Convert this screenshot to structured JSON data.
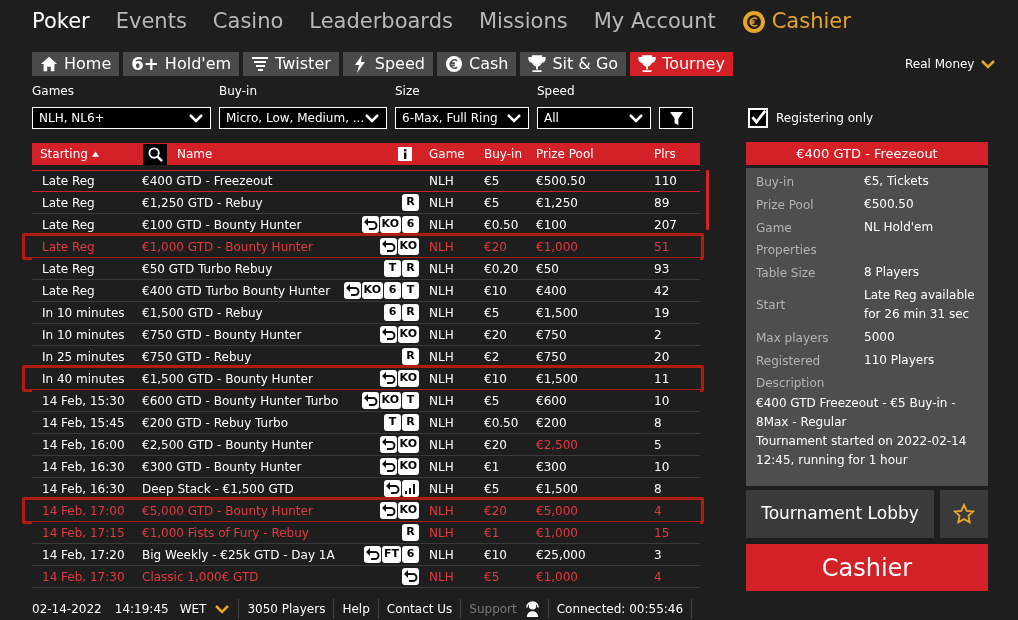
{
  "nav": [
    {
      "label": "Poker",
      "kind": "plain",
      "selected": true
    },
    {
      "label": "Events",
      "kind": "plain",
      "selected": false
    },
    {
      "label": "Casino",
      "kind": "plain",
      "selected": false
    },
    {
      "label": "Leaderboards",
      "kind": "plain",
      "selected": false
    },
    {
      "label": "Missions",
      "kind": "plain",
      "selected": false
    },
    {
      "label": "My Account",
      "kind": "plain",
      "selected": false
    },
    {
      "label": "Cashier",
      "kind": "cashier",
      "selected": false
    }
  ],
  "tabs": [
    {
      "label": "Home",
      "selected": false
    },
    {
      "label": "Hold'em",
      "icon_text": "6+",
      "selected": false
    },
    {
      "label": "Twister",
      "selected": false
    },
    {
      "label": "Speed",
      "selected": false
    },
    {
      "label": "Cash",
      "selected": false
    },
    {
      "label": "Sit & Go",
      "selected": false
    },
    {
      "label": "Tourney",
      "selected": true
    }
  ],
  "money_mode": "Real Money",
  "filters": [
    {
      "label": "Games",
      "value": "NLH, NL6+"
    },
    {
      "label": "Buy-in",
      "value": "Micro, Low, Medium, ..."
    },
    {
      "label": "Size",
      "value": "6-Max, Full Ring"
    },
    {
      "label": "Speed",
      "value": "All"
    }
  ],
  "registering_only": {
    "label": "Registering only",
    "checked": true
  },
  "table": {
    "columns": [
      "Starting",
      "Name",
      "Game",
      "Buy-in",
      "Prize Pool",
      "Plrs"
    ],
    "rows": [
      {
        "starting": "Late Reg",
        "name": "€400 GTD - Freezeout",
        "tags": [],
        "game": "NLH",
        "buy_in": "€5",
        "prize_pool": "€500.50",
        "players": "110",
        "selected": true,
        "alert": false,
        "outlined": false,
        "prize_alert": false
      },
      {
        "starting": "Late Reg",
        "name": "€1,250 GTD - Rebuy",
        "tags": [
          {
            "kind": "text",
            "label": "R"
          }
        ],
        "game": "NLH",
        "buy_in": "€5",
        "prize_pool": "€1,250",
        "players": "89",
        "selected": false,
        "alert": false,
        "outlined": false,
        "prize_alert": false
      },
      {
        "starting": "Late Reg",
        "name": "€100 GTD - Bounty Hunter",
        "tags": [
          {
            "kind": "arrow"
          },
          {
            "kind": "text",
            "label": "KO"
          },
          {
            "kind": "text",
            "label": "6"
          }
        ],
        "game": "NLH",
        "buy_in": "€0.50",
        "prize_pool": "€100",
        "players": "207",
        "selected": false,
        "alert": false,
        "outlined": false,
        "prize_alert": false
      },
      {
        "starting": "Late Reg",
        "name": "€1,000 GTD - Bounty Hunter",
        "tags": [
          {
            "kind": "arrow"
          },
          {
            "kind": "text",
            "label": "KO"
          }
        ],
        "game": "NLH",
        "buy_in": "€20",
        "prize_pool": "€1,000",
        "players": "51",
        "selected": false,
        "alert": true,
        "outlined": true,
        "prize_alert": false
      },
      {
        "starting": "Late Reg",
        "name": "€50 GTD Turbo Rebuy",
        "tags": [
          {
            "kind": "text",
            "label": "T"
          },
          {
            "kind": "text",
            "label": "R"
          }
        ],
        "game": "NLH",
        "buy_in": "€0.20",
        "prize_pool": "€50",
        "players": "93",
        "selected": false,
        "alert": false,
        "outlined": false,
        "prize_alert": false
      },
      {
        "starting": "Late Reg",
        "name": "€400 GTD Turbo Bounty Hunter",
        "tags": [
          {
            "kind": "arrow"
          },
          {
            "kind": "text",
            "label": "KO"
          },
          {
            "kind": "text",
            "label": "6"
          },
          {
            "kind": "text",
            "label": "T"
          }
        ],
        "game": "NLH",
        "buy_in": "€10",
        "prize_pool": "€400",
        "players": "42",
        "selected": false,
        "alert": false,
        "outlined": false,
        "prize_alert": false
      },
      {
        "starting": "In 10 minutes",
        "name": "€1,500 GTD - Rebuy",
        "tags": [
          {
            "kind": "text",
            "label": "6"
          },
          {
            "kind": "text",
            "label": "R"
          }
        ],
        "game": "NLH",
        "buy_in": "€5",
        "prize_pool": "€1,500",
        "players": "19",
        "selected": false,
        "alert": false,
        "outlined": false,
        "prize_alert": false
      },
      {
        "starting": "In 10 minutes",
        "name": "€750 GTD - Bounty Hunter",
        "tags": [
          {
            "kind": "arrow"
          },
          {
            "kind": "text",
            "label": "KO"
          }
        ],
        "game": "NLH",
        "buy_in": "€20",
        "prize_pool": "€750",
        "players": "2",
        "selected": false,
        "alert": false,
        "outlined": false,
        "prize_alert": false
      },
      {
        "starting": "In 25 minutes",
        "name": "€750 GTD - Rebuy",
        "tags": [
          {
            "kind": "text",
            "label": "R"
          }
        ],
        "game": "NLH",
        "buy_in": "€2",
        "prize_pool": "€750",
        "players": "20",
        "selected": false,
        "alert": false,
        "outlined": false,
        "prize_alert": false
      },
      {
        "starting": "In 40 minutes",
        "name": "€1,500 GTD - Bounty Hunter",
        "tags": [
          {
            "kind": "arrow"
          },
          {
            "kind": "text",
            "label": "KO"
          }
        ],
        "game": "NLH",
        "buy_in": "€10",
        "prize_pool": "€1,500",
        "players": "11",
        "selected": false,
        "alert": false,
        "outlined": true,
        "prize_alert": false
      },
      {
        "starting": "14 Feb, 15:30",
        "name": "€600 GTD - Bounty Hunter Turbo",
        "tags": [
          {
            "kind": "arrow"
          },
          {
            "kind": "text",
            "label": "KO"
          },
          {
            "kind": "text",
            "label": "T"
          }
        ],
        "game": "NLH",
        "buy_in": "€5",
        "prize_pool": "€600",
        "players": "10",
        "selected": false,
        "alert": false,
        "outlined": false,
        "prize_alert": false
      },
      {
        "starting": "14 Feb, 15:45",
        "name": "€200 GTD - Rebuy Turbo",
        "tags": [
          {
            "kind": "text",
            "label": "T"
          },
          {
            "kind": "text",
            "label": "R"
          }
        ],
        "game": "NLH",
        "buy_in": "€0.50",
        "prize_pool": "€200",
        "players": "8",
        "selected": false,
        "alert": false,
        "outlined": false,
        "prize_alert": false
      },
      {
        "starting": "14 Feb, 16:00",
        "name": "€2,500 GTD - Bounty Hunter",
        "tags": [
          {
            "kind": "arrow"
          },
          {
            "kind": "text",
            "label": "KO"
          }
        ],
        "game": "NLH",
        "buy_in": "€20",
        "prize_pool": "€2,500",
        "players": "5",
        "selected": false,
        "alert": false,
        "outlined": false,
        "prize_alert": true
      },
      {
        "starting": "14 Feb, 16:30",
        "name": "€300 GTD - Bounty Hunter",
        "tags": [
          {
            "kind": "arrow"
          },
          {
            "kind": "text",
            "label": "KO"
          }
        ],
        "game": "NLH",
        "buy_in": "€1",
        "prize_pool": "€300",
        "players": "10",
        "selected": false,
        "alert": false,
        "outlined": false,
        "prize_alert": false
      },
      {
        "starting": "14 Feb, 16:30",
        "name": "Deep Stack - €1,500 GTD",
        "tags": [
          {
            "kind": "arrow"
          },
          {
            "kind": "bars"
          }
        ],
        "game": "NLH",
        "buy_in": "€5",
        "prize_pool": "€1,500",
        "players": "8",
        "selected": false,
        "alert": false,
        "outlined": false,
        "prize_alert": false
      },
      {
        "starting": "14 Feb, 17:00",
        "name": "€5,000 GTD - Bounty Hunter",
        "tags": [
          {
            "kind": "arrow"
          },
          {
            "kind": "text",
            "label": "KO"
          }
        ],
        "game": "NLH",
        "buy_in": "€20",
        "prize_pool": "€5,000",
        "players": "4",
        "selected": false,
        "alert": true,
        "outlined": true,
        "prize_alert": false
      },
      {
        "starting": "14 Feb, 17:15",
        "name": "€1,000 Fists of Fury - Rebuy",
        "tags": [
          {
            "kind": "text",
            "label": "R"
          }
        ],
        "game": "NLH",
        "buy_in": "€1",
        "prize_pool": "€1,000",
        "players": "15",
        "selected": false,
        "alert": true,
        "outlined": false,
        "prize_alert": false
      },
      {
        "starting": "14 Feb, 17:20",
        "name": "Big Weekly - €25k GTD - Day 1A",
        "tags": [
          {
            "kind": "arrow"
          },
          {
            "kind": "text",
            "label": "FT"
          },
          {
            "kind": "text",
            "label": "6"
          }
        ],
        "game": "NLH",
        "buy_in": "€10",
        "prize_pool": "€25,000",
        "players": "3",
        "selected": false,
        "alert": false,
        "outlined": false,
        "prize_alert": false
      },
      {
        "starting": "14 Feb, 17:30",
        "name": "Classic 1,000€ GTD",
        "tags": [
          {
            "kind": "arrow"
          }
        ],
        "game": "NLH",
        "buy_in": "€5",
        "prize_pool": "€1,000",
        "players": "4",
        "selected": false,
        "alert": true,
        "outlined": false,
        "prize_alert": false
      }
    ]
  },
  "details": {
    "title": "€400 GTD - Freezeout",
    "fields": [
      {
        "label": "Buy-in",
        "value": "€5, Tickets"
      },
      {
        "label": "Prize Pool",
        "value": "€500.50"
      },
      {
        "label": "Game",
        "value": "NL Hold'em"
      },
      {
        "label": "Properties"
      },
      {
        "label": "Table Size",
        "value": "8 Players"
      },
      {
        "label": "Start",
        "value": "Late Reg available for 26 min 31 sec"
      },
      {
        "label": "Max players",
        "value": "5000"
      },
      {
        "label": "Registered",
        "value": "110 Players"
      }
    ],
    "description_label": "Description",
    "description": [
      "€400 GTD Freezeout - €5 Buy-in - 8Max - Regular",
      "Tournament started on 2022-02-14 12:45, running for 1 hour"
    ]
  },
  "buttons": {
    "lobby": "Tournament Lobby",
    "cashier": "Cashier"
  },
  "status_bar": {
    "date": "02-14-2022",
    "time": "14:19:45",
    "timezone": "WET",
    "players": "3050 Players",
    "help": "Help",
    "contact": "Contact Us",
    "support": {
      "label": "Support",
      "disabled": true
    },
    "connection": "Connected: 00:55:46"
  }
}
